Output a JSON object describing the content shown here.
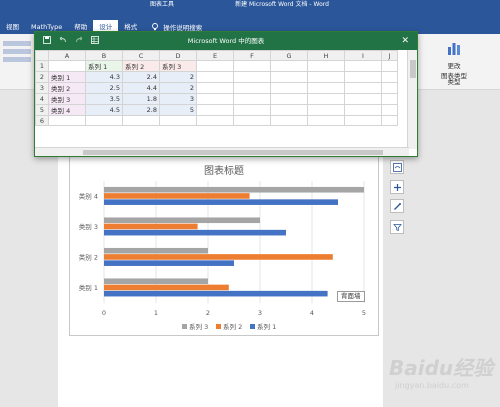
{
  "ribbon": {
    "context_tab": "图表工具",
    "window_title": "新建 Microsoft Word 文档 - Word",
    "tabs": [
      "视图",
      "MathType",
      "帮助",
      "设计",
      "格式"
    ],
    "active_tab": 3,
    "tell_me": "操作说明搜索",
    "edit_data_label_1": "更改",
    "edit_data_label_2": "图表类型",
    "group_label": "类型"
  },
  "datasheet": {
    "title": "Microsoft Word 中的图表",
    "col_headers": [
      "A",
      "B",
      "C",
      "D",
      "E",
      "F",
      "G",
      "H",
      "I",
      "J"
    ],
    "row_numbers": [
      "1",
      "2",
      "3",
      "4",
      "5",
      "6"
    ],
    "header_row": [
      "",
      "系列 1",
      "系列 2",
      "系列 3"
    ],
    "rows": [
      [
        "类别 1",
        "4.3",
        "2.4",
        "2"
      ],
      [
        "类别 2",
        "2.5",
        "4.4",
        "2"
      ],
      [
        "类别 3",
        "3.5",
        "1.8",
        "3"
      ],
      [
        "类别 4",
        "4.5",
        "2.8",
        "5"
      ]
    ]
  },
  "tooltip": "背面墙",
  "watermark": {
    "brand": "Bai",
    "brand2": "du",
    "suffix": "经验",
    "sub": "jingyan.baidu.com"
  },
  "colors": {
    "series1": "#4472c4",
    "series2": "#ed7d31",
    "series3": "#a5a5a5"
  },
  "chart_data": {
    "type": "bar",
    "orientation": "horizontal",
    "title": "图表标题",
    "categories": [
      "类别 1",
      "类别 2",
      "类别 3",
      "类别 4"
    ],
    "series": [
      {
        "name": "系列 1",
        "values": [
          4.3,
          2.5,
          3.5,
          4.5
        ]
      },
      {
        "name": "系列 2",
        "values": [
          2.4,
          4.4,
          1.8,
          2.8
        ]
      },
      {
        "name": "系列 3",
        "values": [
          2,
          2,
          3,
          5
        ]
      }
    ],
    "xlim": [
      0,
      5
    ],
    "x_ticks": [
      "0",
      "1",
      "2",
      "3",
      "4",
      "5"
    ],
    "legend": [
      "系列 3",
      "系列 2",
      "系列 1"
    ],
    "legend_position": "bottom",
    "grid": true
  }
}
